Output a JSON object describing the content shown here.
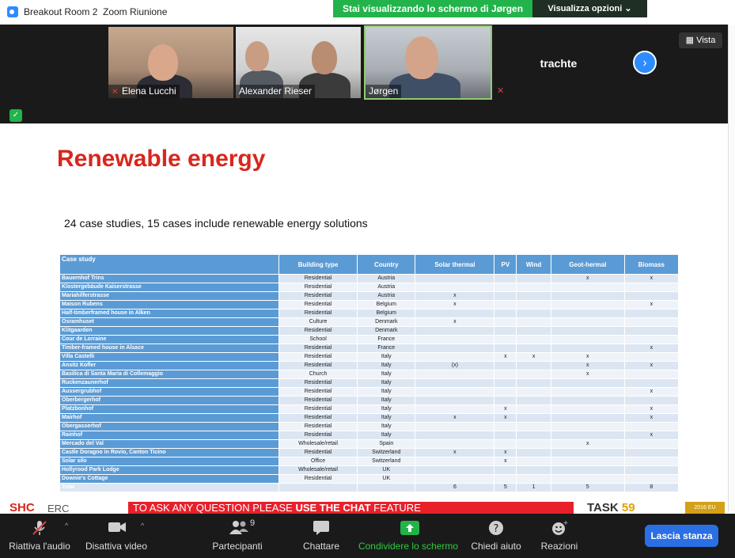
{
  "window": {
    "title_room": "Breakout Room 2",
    "title_app": "Zoom Riunione"
  },
  "share_banner": {
    "text": "Stai visualizzando lo schermo di Jørgen"
  },
  "view_options": {
    "label": "Visualizza opzioni",
    "icon": "chevron-down-icon"
  },
  "view_button": {
    "label": "Vista",
    "icon": "grid-icon"
  },
  "participants_strip": {
    "tiles": [
      {
        "name": "Elena Lucchi",
        "muted": true
      },
      {
        "name": "Alexander Rieser",
        "muted": false
      },
      {
        "name": "Jørgen",
        "muted": false,
        "active": true
      },
      {
        "name": "trachte",
        "muted": true
      }
    ],
    "next_icon": "chevron-right-icon"
  },
  "slide": {
    "title": "Renewable energy",
    "subtitle": "24 case studies, 15 cases include renewable energy solutions",
    "table": {
      "headers": [
        "Case study",
        "Building type",
        "Country",
        "Solar thermal",
        "PV",
        "Wind",
        "Geot-hermal",
        "Biomass"
      ],
      "rows": [
        [
          "Bauernhof Trins",
          "Residential",
          "Austria",
          "",
          "",
          "",
          "x",
          "x"
        ],
        [
          "Klostergebäude Kaiserstrasse",
          "Residential",
          "Austria",
          "",
          "",
          "",
          "",
          ""
        ],
        [
          "Mariahilferstrasse",
          "Residential",
          "Austria",
          "x",
          "",
          "",
          "",
          ""
        ],
        [
          "Maison Rubens",
          "Residential",
          "Belgium",
          "x",
          "",
          "",
          "",
          "x"
        ],
        [
          "Half-timberframed house in Alken",
          "Residential",
          "Belgium",
          "",
          "",
          "",
          "",
          ""
        ],
        [
          "Osramhuset",
          "Culture",
          "Denmark",
          "x",
          "",
          "",
          "",
          ""
        ],
        [
          "Klitgaarden",
          "Residential",
          "Denmark",
          "",
          "",
          "",
          "",
          ""
        ],
        [
          "Cour de Lorraine",
          "School",
          "France",
          "",
          "",
          "",
          "",
          ""
        ],
        [
          "Timber-framed house in Alsace",
          "Residential",
          "France",
          "",
          "",
          "",
          "",
          "x"
        ],
        [
          "Villa Castelli",
          "Residential",
          "Italy",
          "",
          "x",
          "x",
          "x",
          ""
        ],
        [
          "Ansitz Kofler",
          "Residential",
          "Italy",
          "(x)",
          "",
          "",
          "x",
          "x"
        ],
        [
          "Basilica di Santa Maria di Collemaggio",
          "Church",
          "Italy",
          "",
          "",
          "",
          "x",
          ""
        ],
        [
          "Ruckenzaunerhof",
          "Residential",
          "Italy",
          "",
          "",
          "",
          "",
          ""
        ],
        [
          "Aussergrubhof",
          "Residential",
          "Italy",
          "",
          "",
          "",
          "",
          "x"
        ],
        [
          "Oberbergerhof",
          "Residential",
          "Italy",
          "",
          "",
          "",
          "",
          ""
        ],
        [
          "Platzbonhof",
          "Residential",
          "Italy",
          "",
          "x",
          "",
          "",
          "x"
        ],
        [
          "Mairhof",
          "Residential",
          "Italy",
          "x",
          "x",
          "",
          "",
          "x"
        ],
        [
          "Obergasserhof",
          "Residential",
          "Italy",
          "",
          "",
          "",
          "",
          ""
        ],
        [
          "Rainhof",
          "Residential",
          "Italy",
          "",
          "",
          "",
          "",
          "x"
        ],
        [
          "Mercado del Val",
          "Wholesale/retail",
          "Spain",
          "",
          "",
          "",
          "x",
          ""
        ],
        [
          "Castle Doragno in Rovio, Canton Ticino",
          "Residential",
          "Switzerland",
          "x",
          "x",
          "",
          "",
          ""
        ],
        [
          "Solar silo",
          "Office",
          "Switzerland",
          "",
          "x",
          "",
          "",
          ""
        ],
        [
          "Hollyrood Park Lodge",
          "Wholesale/retail",
          "UK",
          "",
          "",
          "",
          "",
          ""
        ],
        [
          "Downie's Cottage",
          "Residential",
          "UK",
          "",
          "",
          "",
          "",
          ""
        ]
      ],
      "total": [
        "Total",
        "",
        "",
        "6",
        "5",
        "1",
        "5",
        "8"
      ]
    },
    "footer": {
      "logo_text": "SHC",
      "erc_text": "ERC",
      "banner_prefix": "TO ASK ANY QUESTION PLEASE ",
      "banner_bold": "USE THE CHAT",
      "banner_suffix": " FEATURE",
      "task_text": "TASK ",
      "task_number": "59",
      "badge_text": "2016 EU"
    }
  },
  "toolbar": {
    "audio_label": "Riattiva l'audio",
    "video_label": "Disattiva video",
    "participants_label": "Partecipanti",
    "participants_count": "9",
    "chat_label": "Chattare",
    "share_label": "Condividere lo schermo",
    "help_label": "Chiedi aiuto",
    "reactions_label": "Reazioni",
    "leave_label": "Lascia stanza"
  },
  "colors": {
    "accent": "#2d8cff",
    "share_green": "#22b34a",
    "slide_red": "#d9261c",
    "table_blue": "#5b9bd5"
  }
}
